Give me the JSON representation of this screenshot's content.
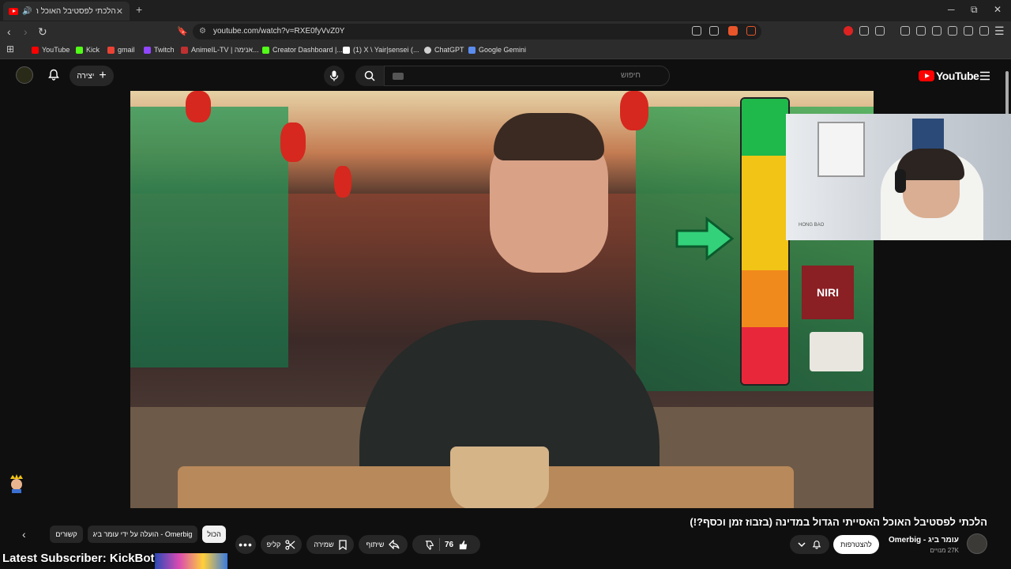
{
  "browser": {
    "tab_title": "הלכתי לפסטיבל האוכל האסיי...",
    "url": "youtube.com/watch?v=RXE0fyVvZ0Y",
    "bookmarks": [
      {
        "label": "YouTube",
        "color": "#ff0000"
      },
      {
        "label": "Kick",
        "color": "#53fc18"
      },
      {
        "label": "gmail",
        "color": "#ea4335"
      },
      {
        "label": "Twitch",
        "color": "#9146ff"
      },
      {
        "label": "AnimeIL-TV | אנימה...",
        "color": "#c03030"
      },
      {
        "label": "Creator Dashboard |...",
        "color": "#53fc18"
      },
      {
        "label": "(1) X \\ Yair|sensei (...",
        "color": "#ffffff"
      },
      {
        "label": "ChatGPT",
        "color": "#d0d0d0"
      },
      {
        "label": "Google Gemini",
        "color": "#5b8def"
      }
    ]
  },
  "youtube": {
    "logo_text": "YouTube",
    "search_placeholder": "חיפוש",
    "create_label": "יצירה"
  },
  "video": {
    "title": "הלכתי לפסטיבל האוכל האסייתי הגדול במדינה (בזבוז זמן וכסף?!)",
    "sign_text": "NIRI",
    "facecam_label": "HONG BAO",
    "meter_colors": [
      "#1fb84b",
      "#f2c416",
      "#f2c416",
      "#f08a1c",
      "#e8283a"
    ]
  },
  "channel": {
    "name": "עומר ביג - Omerbig",
    "subscribers": "27K מנויים",
    "join_label": "להצטרפות"
  },
  "actions": {
    "like_count": "76",
    "share_label": "שיתוף",
    "save_label": "שמירה",
    "clip_label": "קליפ"
  },
  "chips": {
    "all": "הכול",
    "uploaded_by": "הועלה על ידי עומר ביג - Omerbig",
    "related": "קשורים"
  },
  "overlay": {
    "latest_subscriber": "Latest Subscriber: KickBot"
  }
}
